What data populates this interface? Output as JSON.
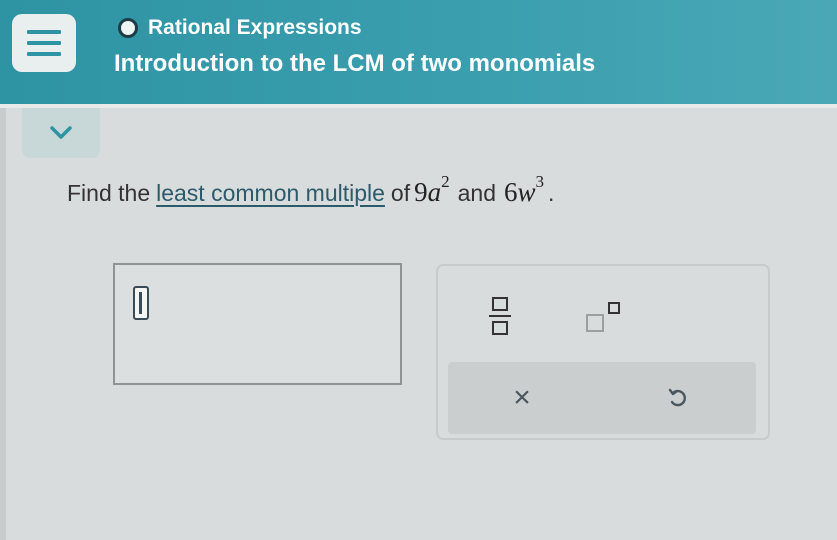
{
  "header": {
    "topic": "Rational Expressions",
    "lesson": "Introduction to the LCM of two monomials"
  },
  "problem": {
    "prefix": "Find the",
    "link_text": "least common multiple",
    "of_text": "of",
    "term1_coef": "9",
    "term1_var": "a",
    "term1_exp": "2",
    "and_text": "and",
    "term2_coef": "6",
    "term2_var": "w",
    "term2_exp": "3",
    "period": "."
  },
  "keypad": {
    "clear_symbol": "×"
  },
  "icons": {
    "menu": "hamburger-icon",
    "collapse": "chevron-down-icon",
    "fraction": "fraction-icon",
    "superscript": "superscript-icon",
    "undo": "undo-icon"
  },
  "colors": {
    "header": "#3a9eae",
    "accent": "#2e93a3",
    "link": "#2b5a6a"
  }
}
